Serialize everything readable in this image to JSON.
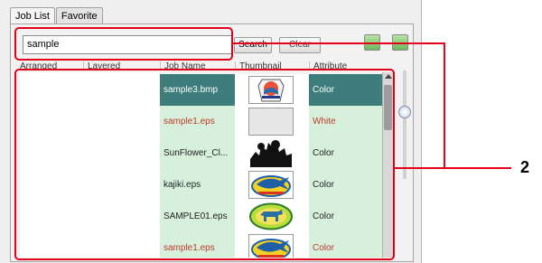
{
  "tabs": [
    {
      "label": "Job List",
      "active": true
    },
    {
      "label": "Favorite",
      "active": false
    }
  ],
  "search": {
    "value": "sample",
    "button_label": "Search",
    "clear_label": "Clear",
    "extra_label": "  "
  },
  "columns": [
    "Arranged",
    "Layered",
    "Job Name",
    "Thumbnail",
    "Attribute"
  ],
  "rows": [
    {
      "name": "sample3.bmp",
      "attribute": "Color",
      "thumb": "emblem-icon",
      "selected": true,
      "text_color": "#ffffff"
    },
    {
      "name": "sample1.eps",
      "attribute": "White",
      "thumb": "blank-gray-icon",
      "selected": false,
      "text_color": "#c0392b"
    },
    {
      "name": "SunFlower_Cl...",
      "attribute": "Color",
      "thumb": "sunflower-silhouette-icon",
      "selected": false,
      "text_color": "#222222"
    },
    {
      "name": "kajiki.eps",
      "attribute": "Color",
      "thumb": "marlin-logo-icon",
      "selected": false,
      "text_color": "#222222"
    },
    {
      "name": "SAMPLE01.eps",
      "attribute": "Color",
      "thumb": "animal-badge-icon",
      "selected": false,
      "text_color": "#222222"
    },
    {
      "name": "sample1.eps",
      "attribute": "Color",
      "thumb": "marlin-logo-icon",
      "selected": false,
      "text_color": "#c0392b"
    }
  ],
  "colors": {
    "row_bg": "#d6f0dc",
    "selected_bg": "#3d7d7b",
    "callout": "#e2001a"
  },
  "callout": {
    "number": "2"
  }
}
